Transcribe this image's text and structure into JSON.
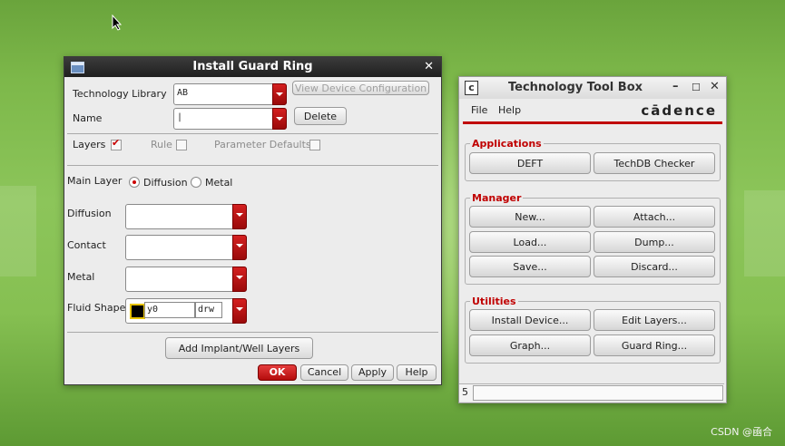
{
  "install_guard_ring": {
    "title": "Install Guard Ring",
    "technology_library_label": "Technology Library",
    "technology_library_value": "AB",
    "view_device_config_label": "View Device Configuration",
    "name_label": "Name",
    "name_value": "|",
    "delete_label": "Delete",
    "layers_label": "Layers",
    "rule_label": "Rule",
    "parameter_defaults_label": "Parameter Defaults",
    "main_layer_label": "Main Layer",
    "diffusion_option": "Diffusion",
    "metal_option": "Metal",
    "diffusion_label": "Diffusion",
    "contact_label": "Contact",
    "metal_label": "Metal",
    "fluid_shape_label": "Fluid Shape",
    "fluid_shape_layer": "y0",
    "fluid_shape_purpose": "drw",
    "add_implant_label": "Add Implant/Well Layers",
    "ok_label": "OK",
    "cancel_label": "Cancel",
    "apply_label": "Apply",
    "help_label": "Help"
  },
  "toolbox": {
    "title": "Technology Tool Box",
    "menu_file": "File",
    "menu_help": "Help",
    "logo": "cādence",
    "applications_title": "Applications",
    "deft": "DEFT",
    "techdb_checker": "TechDB Checker",
    "manager_title": "Manager",
    "new": "New...",
    "attach": "Attach...",
    "load": "Load...",
    "dump": "Dump...",
    "save": "Save...",
    "discard": "Discard...",
    "utilities_title": "Utilities",
    "install_device": "Install Device...",
    "edit_layers": "Edit Layers...",
    "graph": "Graph...",
    "guard_ring": "Guard Ring...",
    "status_value": "5"
  },
  "watermark": "CSDN @凾合",
  "colors": {
    "accent_red": "#c00000",
    "desktop_green": "#7db84a"
  }
}
